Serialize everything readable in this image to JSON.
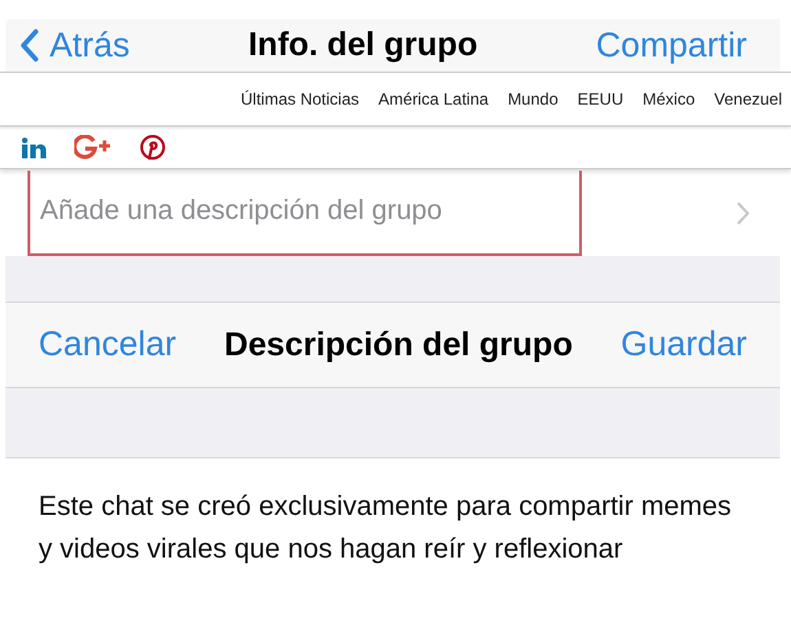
{
  "top_bar": {
    "back": "Atrás",
    "title": "Info. del grupo",
    "action": "Compartir"
  },
  "news_nav": [
    "Últimas Noticias",
    "América Latina",
    "Mundo",
    "EEUU",
    "México",
    "Venezuel"
  ],
  "description_row": {
    "placeholder": "Añade una descripción del grupo"
  },
  "edit_bar": {
    "cancel": "Cancelar",
    "title": "Descripción del grupo",
    "save": "Guardar"
  },
  "description_text": "Este chat se creó exclusivamente para compartir memes y videos virales que nos hagan reír y reflexionar"
}
